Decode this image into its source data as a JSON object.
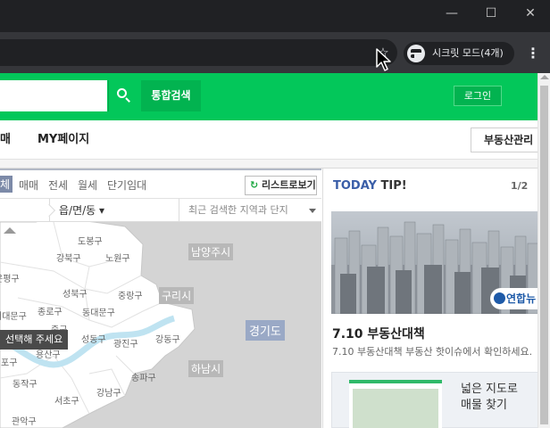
{
  "browser": {
    "incognito_label": "시크릿 모드(4개)",
    "window_controls": {
      "minimize": "—",
      "maximize": "☐",
      "close": "✕"
    },
    "bookmark_icon": "star-icon",
    "menu_icon": "more-vert-icon"
  },
  "header": {
    "search_icon": "search-icon",
    "unified_search_label": "통합검색",
    "login_label": "로그인",
    "colors": {
      "brand": "#03c75a"
    }
  },
  "nav": {
    "items": [
      "매",
      "MY페이지"
    ],
    "realty_management_label": "부동산관리"
  },
  "filters": {
    "tabs": [
      "체",
      "매매",
      "전세",
      "월세",
      "단기임대"
    ],
    "active_index": 0,
    "list_view_label": "리스트로보기"
  },
  "location": {
    "select_label": "읍/면/동",
    "recent_label": "최근 검색한 지역과 단지"
  },
  "map": {
    "districts": [
      "도봉구",
      "노원구",
      "강북구",
      "은평구",
      "성북구",
      "중랑구",
      "종로구",
      "동대문구",
      "서대문구",
      "중구",
      "성동구",
      "광진구",
      "강동구",
      "용산구",
      "포구",
      "동작구",
      "서초구",
      "강남구",
      "송파구",
      "관악구"
    ],
    "cities": [
      "남양주시",
      "구리시",
      "하남시"
    ],
    "province": "경기도",
    "tooltip": "선택해 주세요"
  },
  "today_tip": {
    "title_today": "TODAY",
    "title_tip": "TIP!",
    "page": "1/2",
    "image_credit": "연합뉴",
    "headline": "7.10 부동산대책",
    "description": "7.10 부동산대책 부동산 핫이슈에서 확인하세요.",
    "promo_line1": "넓은 지도로",
    "promo_line2": "매물 찾기"
  }
}
